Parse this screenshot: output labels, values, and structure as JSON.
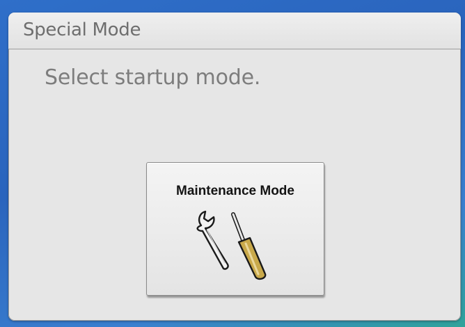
{
  "dialog": {
    "title": "Special Mode",
    "prompt": "Select startup mode."
  },
  "buttons": [
    {
      "label": "Maintenance Mode",
      "icon": "wrench-and-screwdriver-icon"
    }
  ],
  "colors": {
    "background": "#2f6fc9",
    "dialog_background": "#e6e6e6",
    "title_text": "#6e6e6e",
    "prompt_text": "#7d7d7d",
    "button_label": "#141414",
    "screwdriver_handle": "#c9a94a"
  }
}
